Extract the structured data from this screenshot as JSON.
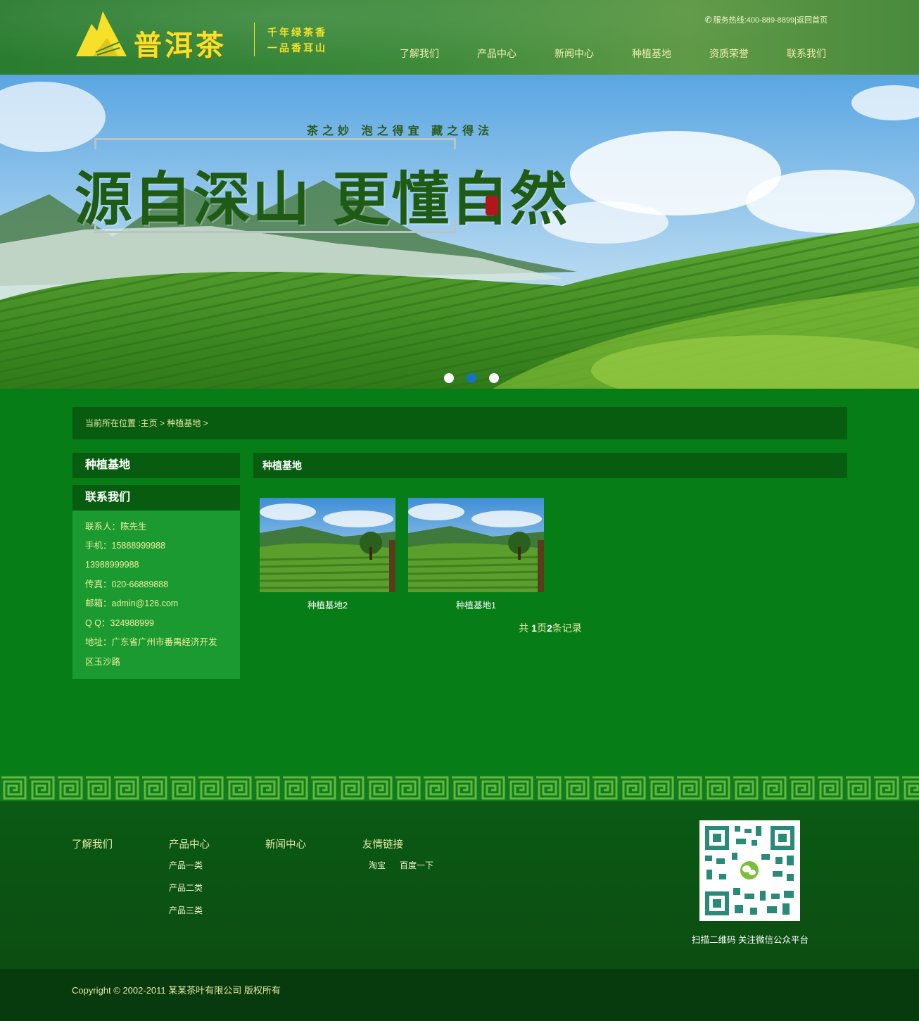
{
  "header": {
    "brand": "普洱茶",
    "slogan_line1": "千年绿茶香",
    "slogan_line2": "一品香耳山",
    "hotline": "服务热线:400-889-8899|返回首页",
    "nav": [
      {
        "label": "了解我们"
      },
      {
        "label": "产品中心"
      },
      {
        "label": "新闻中心"
      },
      {
        "label": "种植基地"
      },
      {
        "label": "资质荣誉"
      },
      {
        "label": "联系我们"
      }
    ]
  },
  "banner": {
    "tagline": "茶之妙 泡之得宜 藏之得法",
    "title": "源自深山 更懂自然",
    "active_slide": 2,
    "slide_count": 3
  },
  "breadcrumb": {
    "prefix": "当前所在位置 :",
    "home": "主页",
    "sep": ">",
    "current": "种植基地"
  },
  "sidebar": {
    "category_title": "种植基地",
    "contact_title": "联系我们",
    "contact_lines": [
      "联系人：陈先生",
      "手机：15888999988",
      "13988999988",
      "传真：020-66889888",
      "邮箱：admin@126.com",
      "Q Q：324988999",
      "地址：广东省广州市番禺经济开发",
      "区玉沙路"
    ]
  },
  "main": {
    "title": "种植基地",
    "items": [
      {
        "caption": "种植基地2"
      },
      {
        "caption": "种植基地1"
      }
    ],
    "pager": {
      "prefix": "共 ",
      "pages": "1",
      "mid": "页",
      "count": "2",
      "suffix": "条记录"
    }
  },
  "footer": {
    "columns": [
      {
        "title": "了解我们",
        "links": []
      },
      {
        "title": "产品中心",
        "links": [
          "产品一类",
          "产品二类",
          "产品三类"
        ]
      },
      {
        "title": "新闻中心",
        "links": []
      },
      {
        "title": "友情链接",
        "links": [
          "淘宝",
          "百度一下"
        ]
      }
    ],
    "qr_caption": "扫描二维码 关注微信公众平台",
    "copyright": "Copyright © 2002-2011 某某茶叶有限公司 版权所有"
  },
  "colors": {
    "page_bg": "#077d17",
    "panel_dark": "#085c10",
    "contact_bg": "#1b9a32",
    "brand_yellow": "#f7e02a",
    "dot_active": "#1672c4"
  },
  "icons": {
    "phone": "phone-icon",
    "logo": "mountain-logo-icon",
    "qr": "qr-code-icon"
  }
}
